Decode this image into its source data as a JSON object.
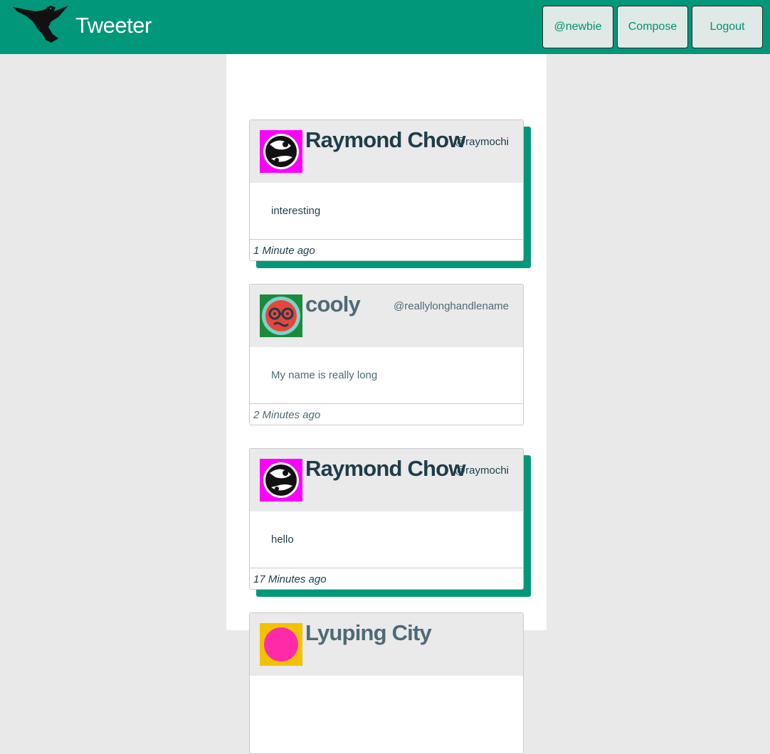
{
  "navbar": {
    "brand": "Tweeter",
    "logo_icon": "hummingbird-icon",
    "buttons": {
      "profile": "@newbie",
      "compose": "Compose",
      "logout": "Logout"
    }
  },
  "colors": {
    "accent": "#00977a",
    "button_text": "#009270",
    "text": "#1d3d4a",
    "background": "#e9e9e9"
  },
  "tweets": [
    {
      "name": "Raymond Chow",
      "handle": "@raymochi",
      "body": "interesting",
      "time": "1 Minute ago",
      "avatar_icon": "eye-creature-avatar-icon",
      "avatar_color": "#ff00ff"
    },
    {
      "name": "cooly",
      "handle": "@reallylonghandlename",
      "body": "My name is really long",
      "time": "2 Minutes ago",
      "avatar_icon": "glasses-face-avatar-icon",
      "avatar_color": "#1b8a3c"
    },
    {
      "name": "Raymond Chow",
      "handle": "@raymochi",
      "body": "hello",
      "time": "17 Minutes ago",
      "avatar_icon": "eye-creature-avatar-icon",
      "avatar_color": "#ff00ff"
    },
    {
      "name": "Lyuping City",
      "avatar_icon": "face-avatar-icon",
      "avatar_color": "#f2c200"
    }
  ]
}
